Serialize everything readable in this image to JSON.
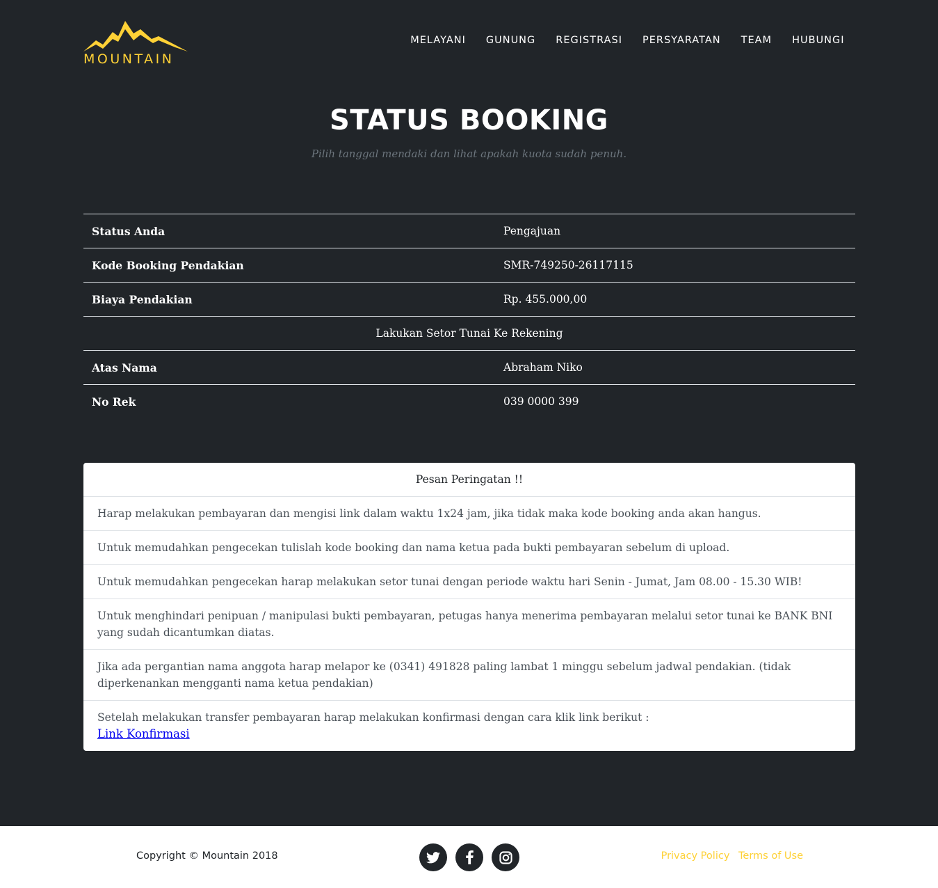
{
  "brand": {
    "name": "MOUNTAIN",
    "accent_color": "#fed136",
    "background_color": "#212529"
  },
  "nav": {
    "items": [
      {
        "label": "MELAYANI"
      },
      {
        "label": "GUNUNG"
      },
      {
        "label": "REGISTRASI"
      },
      {
        "label": "PERSYARATAN"
      },
      {
        "label": "TEAM"
      },
      {
        "label": "HUBUNGI"
      }
    ]
  },
  "page": {
    "title": "STATUS BOOKING",
    "subtitle": "Pilih tanggal mendaki dan lihat apakah kuota sudah penuh."
  },
  "status_table": {
    "rows": [
      {
        "label": "Status Anda",
        "value": "Pengajuan"
      },
      {
        "label": "Kode Booking Pendakian",
        "value": "SMR-749250-26117115"
      },
      {
        "label": "Biaya Pendakian",
        "value": "Rp. 455.000,00"
      },
      {
        "note": "Lakukan Setor Tunai Ke Rekening"
      },
      {
        "label": "Atas Nama",
        "value": "Abraham Niko"
      },
      {
        "label": "No Rek",
        "value": "039 0000 399"
      }
    ]
  },
  "warning": {
    "title": "Pesan Peringatan !!",
    "items": [
      "Harap melakukan pembayaran dan mengisi link dalam waktu 1x24 jam, jika tidak maka kode booking anda akan hangus.",
      "Untuk memudahkan pengecekan tulislah kode booking dan nama ketua pada bukti pembayaran sebelum di upload.",
      "Untuk memudahkan pengecekan harap melakukan setor tunai dengan periode waktu hari Senin - Jumat, Jam 08.00 - 15.30 WIB!",
      "Untuk menghindari penipuan / manipulasi bukti pembayaran, petugas hanya menerima pembayaran melalui setor tunai ke BANK BNI yang sudah dicantumkan diatas.",
      "Jika ada pergantian nama anggota harap melapor ke (0341) 491828 paling lambat 1 minggu sebelum jadwal pendakian. (tidak diperkenankan mengganti nama ketua pendakian)",
      "Setelah melakukan transfer pembayaran harap melakukan konfirmasi dengan cara klik link berikut :"
    ],
    "link_label": "Link Konfirmasi"
  },
  "footer": {
    "copyright": "Copyright © Mountain 2018",
    "social_icons": [
      "twitter-icon",
      "facebook-icon",
      "instagram-icon"
    ],
    "links": [
      {
        "label": "Privacy Policy"
      },
      {
        "label": "Terms of Use"
      }
    ]
  }
}
